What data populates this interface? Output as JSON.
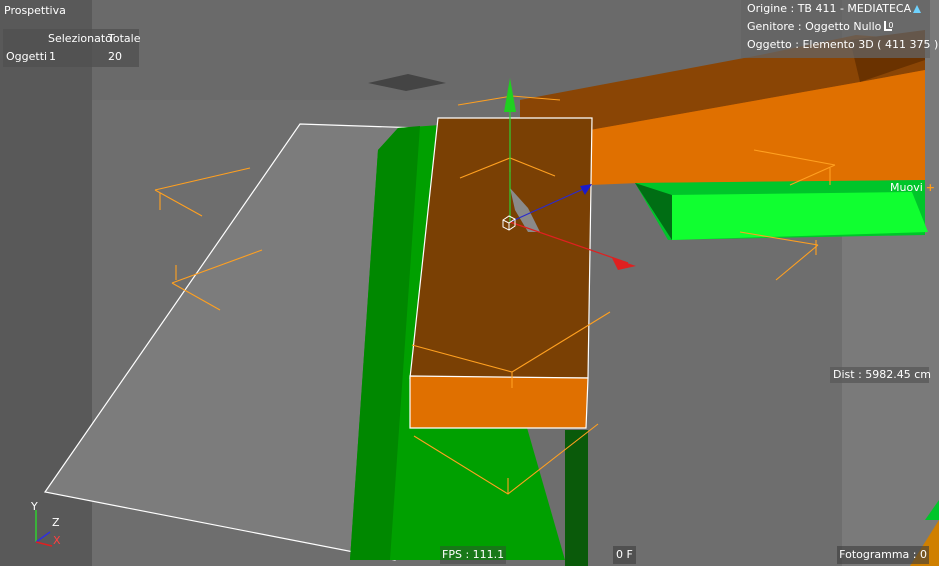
{
  "viewport": {
    "view_name": "Prospettiva",
    "stats": {
      "headers": [
        "Selezionato",
        "Totale"
      ],
      "row_label": "Oggetti",
      "selected": "1",
      "total": "20"
    },
    "info": {
      "origin": "Origine : TB 411 - MEDIATECA",
      "parent": "Genitore : Oggetto Nullo",
      "parent_icon_digit": "0",
      "object": "Oggetto : Elemento 3D ( 411 375 )"
    },
    "tool": "Muovi",
    "distance": "Dist : 5982.45 cm",
    "fps": "FPS : 111.1",
    "frame_offset": "0 F",
    "frame": "Fotogramma : 0",
    "axes": {
      "y": "Y",
      "z": "Z",
      "x": "X"
    }
  },
  "colors": {
    "background": "#6e6e6e",
    "selection_orange": "#e07000",
    "dark_orange": "#7a3f05",
    "green": "#00b000",
    "bright_green": "#00ff33",
    "axis_x": "#e02020",
    "axis_y": "#20d020",
    "axis_z": "#1a1acc"
  }
}
